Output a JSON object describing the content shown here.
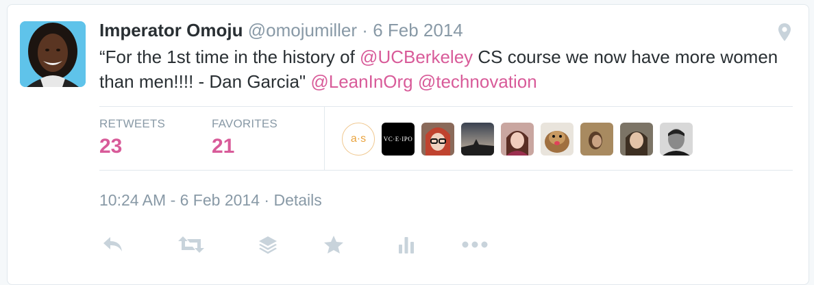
{
  "tweet": {
    "author_name": "Imperator Omoju",
    "author_handle": "@omojumiller",
    "separator": "·",
    "date": "6 Feb 2014",
    "text_segments": [
      {
        "text": "“For the 1st time in the history of ",
        "mention": false
      },
      {
        "text": "@UCBerkeley",
        "mention": true
      },
      {
        "text": " CS course we now have more women than men!!!!  - Dan Garcia\" ",
        "mention": false
      },
      {
        "text": "@LeanInOrg",
        "mention": true
      },
      {
        "text": " ",
        "mention": false
      },
      {
        "text": "@technovation",
        "mention": true
      }
    ],
    "timestamp": "10:24 AM - 6 Feb 2014",
    "details_link": "Details"
  },
  "stats": {
    "retweets_label": "RETWEETS",
    "retweets_count": "23",
    "favorites_label": "FAVORITES",
    "favorites_count": "21"
  },
  "favoriters": [
    {
      "name": "favoriter-avatar-as",
      "label": "a·s"
    },
    {
      "name": "favoriter-avatar-vc",
      "label": "VC·E·IPO"
    },
    {
      "name": "favoriter-avatar-3",
      "label": ""
    },
    {
      "name": "favoriter-avatar-4",
      "label": ""
    },
    {
      "name": "favoriter-avatar-5",
      "label": ""
    },
    {
      "name": "favoriter-avatar-6",
      "label": ""
    },
    {
      "name": "favoriter-avatar-7",
      "label": ""
    },
    {
      "name": "favoriter-avatar-8",
      "label": ""
    },
    {
      "name": "favoriter-avatar-9",
      "label": ""
    }
  ],
  "actions": [
    "reply-icon",
    "retweet-icon",
    "layers-icon",
    "favorite-star-icon",
    "analytics-icon",
    "more-icon"
  ],
  "colors": {
    "link": "#d85b99",
    "muted": "#8899a6",
    "text": "#292f33",
    "border": "#e1e8ed"
  }
}
